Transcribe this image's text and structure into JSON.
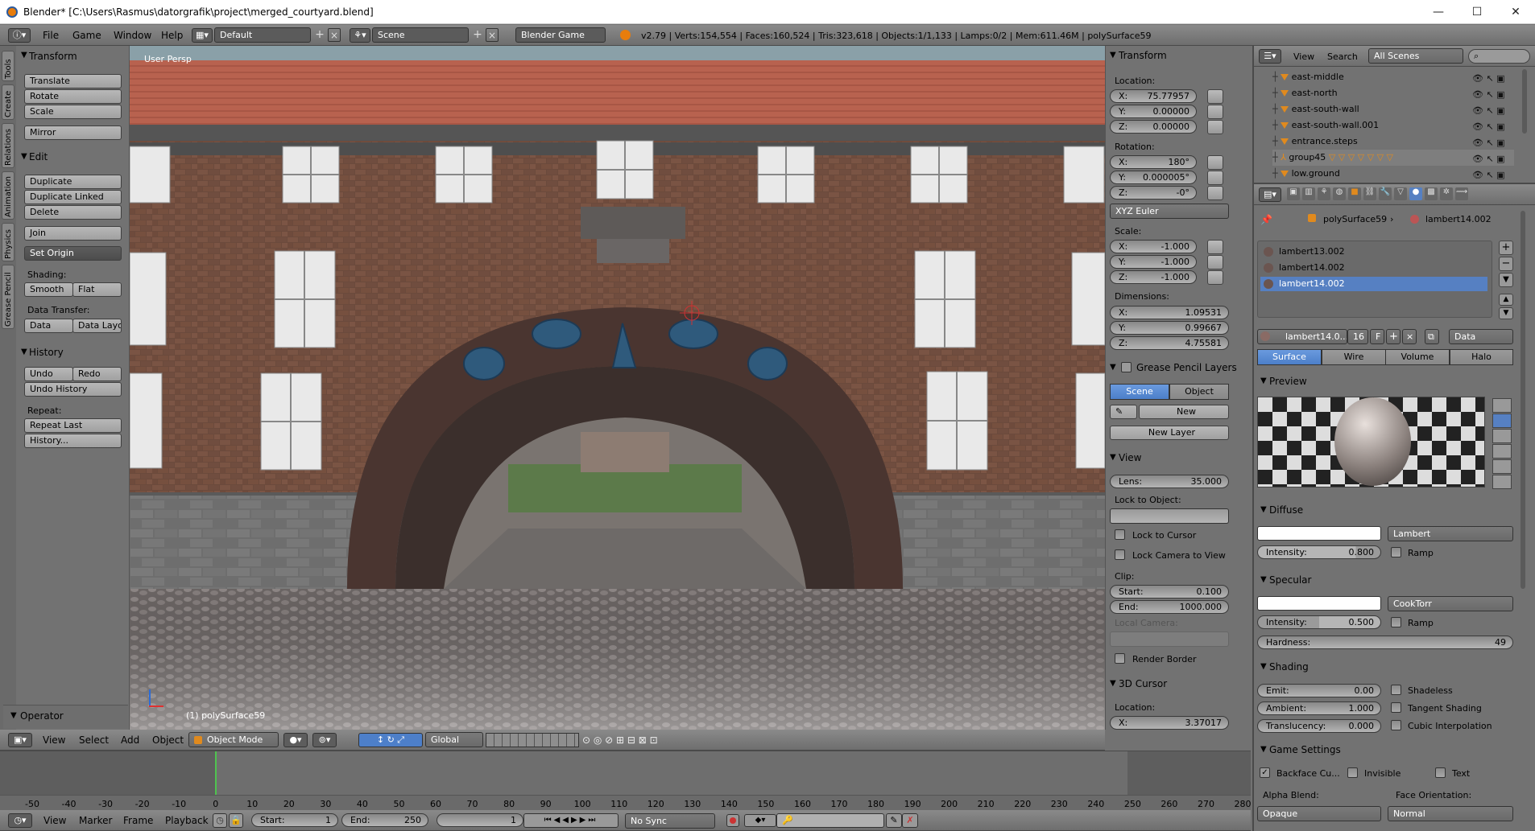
{
  "titlebar": {
    "title": "Blender* [C:\\Users\\Rasmus\\datorgrafik\\project\\merged_courtyard.blend]",
    "minimize": "—",
    "maximize": "☐",
    "close": "✕"
  },
  "info_header": {
    "menus": [
      "File",
      "Game",
      "Window",
      "Help"
    ],
    "layout": "Default",
    "scene": "Scene",
    "engine": "Blender Game",
    "stats": "v2.79 | Verts:154,554 | Faces:160,524 | Tris:323,618 | Objects:1/1,133 | Lamps:0/2 | Mem:611.46M | polySurface59"
  },
  "tool_tabs": [
    "Tools",
    "Create",
    "Relations",
    "Animation",
    "Physics",
    "Grease Pencil"
  ],
  "toolshelf": {
    "transform": {
      "title": "Transform",
      "buttons": [
        "Translate",
        "Rotate",
        "Scale",
        "Mirror"
      ]
    },
    "edit": {
      "title": "Edit",
      "buttons": [
        "Duplicate",
        "Duplicate Linked",
        "Delete",
        "Join"
      ],
      "set_origin": "Set Origin",
      "shading_label": "Shading:",
      "smooth": "Smooth",
      "flat": "Flat",
      "data_transfer_label": "Data Transfer:",
      "data": "Data",
      "data_layo": "Data Layo"
    },
    "history": {
      "title": "History",
      "undo": "Undo",
      "redo": "Redo",
      "undo_history": "Undo History",
      "repeat_label": "Repeat:",
      "repeat_last": "Repeat Last",
      "history_btn": "History..."
    },
    "operator": "Operator"
  },
  "viewport": {
    "view_label": "User Persp",
    "object_label": "(1) polySurface59"
  },
  "view_header": {
    "menus": [
      "View",
      "Select",
      "Add",
      "Object"
    ],
    "mode": "Object Mode",
    "orientation": "Global"
  },
  "properties_n": {
    "transform": {
      "title": "Transform",
      "location_label": "Location:",
      "location": [
        {
          "axis": "X:",
          "value": "75.77957"
        },
        {
          "axis": "Y:",
          "value": "0.00000"
        },
        {
          "axis": "Z:",
          "value": "0.00000"
        }
      ],
      "rotation_label": "Rotation:",
      "rotation": [
        {
          "axis": "X:",
          "value": "180°"
        },
        {
          "axis": "Y:",
          "value": "0.000005°"
        },
        {
          "axis": "Z:",
          "value": "-0°"
        }
      ],
      "rotation_mode": "XYZ Euler",
      "scale_label": "Scale:",
      "scale": [
        {
          "axis": "X:",
          "value": "-1.000"
        },
        {
          "axis": "Y:",
          "value": "-1.000"
        },
        {
          "axis": "Z:",
          "value": "-1.000"
        }
      ],
      "dimensions_label": "Dimensions:",
      "dimensions": [
        {
          "axis": "X:",
          "value": "1.09531"
        },
        {
          "axis": "Y:",
          "value": "0.99667"
        },
        {
          "axis": "Z:",
          "value": "4.75581"
        }
      ]
    },
    "grease": {
      "title": "Grease Pencil Layers",
      "tab_scene": "Scene",
      "tab_object": "Object",
      "new": "New",
      "new_layer": "New Layer"
    },
    "view": {
      "title": "View",
      "lens_label": "Lens:",
      "lens": "35.000",
      "lock_object": "Lock to Object:",
      "lock_cursor": "Lock to Cursor",
      "lock_camera": "Lock Camera to View",
      "clip_label": "Clip:",
      "start_label": "Start:",
      "start": "0.100",
      "end_label": "End:",
      "end": "1000.000",
      "local_camera": "Local Camera:",
      "render_border": "Render Border"
    },
    "cursor": {
      "title": "3D Cursor",
      "location_label": "Location:",
      "x_label": "X:",
      "x": "3.37017"
    }
  },
  "outliner": {
    "menus": [
      "View",
      "Search"
    ],
    "scope": "All Scenes",
    "items": [
      "east-middle",
      "east-north",
      "east-south-wall",
      "east-south-wall.001",
      "entrance.steps",
      "group45",
      "low.ground"
    ]
  },
  "material": {
    "breadcrumb": [
      "polySurface59",
      "lambert14.002"
    ],
    "slots": [
      "lambert13.002",
      "lambert14.002",
      "lambert14.002"
    ],
    "selected_slot": 2,
    "datablock": "lambert14.0...",
    "users": "16",
    "fake": "F",
    "link": "Data",
    "tabs": [
      "Surface",
      "Wire",
      "Volume",
      "Halo"
    ],
    "preview_title": "Preview",
    "diffuse": {
      "title": "Diffuse",
      "shader": "Lambert",
      "intensity_label": "Intensity:",
      "intensity": "0.800",
      "ramp": "Ramp"
    },
    "specular": {
      "title": "Specular",
      "shader": "CookTorr",
      "intensity_label": "Intensity:",
      "intensity": "0.500",
      "ramp": "Ramp",
      "hardness_label": "Hardness:",
      "hardness": "49"
    },
    "shading": {
      "title": "Shading",
      "emit_label": "Emit:",
      "emit": "0.00",
      "ambient_label": "Ambient:",
      "ambient": "1.000",
      "translucency_label": "Translucency:",
      "translucency": "0.000",
      "shadeless": "Shadeless",
      "tangent": "Tangent Shading",
      "cubic": "Cubic Interpolation"
    },
    "game": {
      "title": "Game Settings",
      "backface": "Backface Cu...",
      "invisible": "Invisible",
      "text": "Text",
      "alpha_blend_label": "Alpha Blend:",
      "alpha_blend": "Opaque",
      "face_orientation_label": "Face Orientation:",
      "face_orientation": "Normal"
    }
  },
  "timeline": {
    "ticks": [
      "-50",
      "-40",
      "-30",
      "-20",
      "-10",
      "0",
      "10",
      "20",
      "30",
      "40",
      "50",
      "60",
      "70",
      "80",
      "90",
      "100",
      "110",
      "120",
      "130",
      "140",
      "150",
      "160",
      "170",
      "180",
      "190",
      "200",
      "210",
      "220",
      "230",
      "240",
      "250",
      "260",
      "270",
      "280"
    ],
    "menus": [
      "View",
      "Marker",
      "Frame",
      "Playback"
    ],
    "start_label": "Start:",
    "start": "1",
    "end_label": "End:",
    "end": "250",
    "current": "1",
    "sync": "No Sync"
  },
  "colors": {
    "selected": "#5680c2",
    "panel": "#727272",
    "header": "#7e7e7e"
  }
}
